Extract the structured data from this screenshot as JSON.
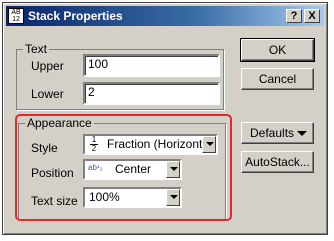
{
  "window": {
    "title": "Stack Properties",
    "help_btn": "?",
    "close_btn": "X"
  },
  "text_group": {
    "label": "Text",
    "upper_label": "Upper",
    "upper_value": "100",
    "lower_label": "Lower",
    "lower_value": "2"
  },
  "appearance_group": {
    "label": "Appearance",
    "style_label": "Style",
    "style_value": "Fraction (Horizontal)",
    "style_icon_num": "1",
    "style_icon_den": "2",
    "position_label": "Position",
    "position_value": "Center",
    "position_icon": "ab¹₂",
    "textsize_label": "Text size",
    "textsize_value": "100%"
  },
  "buttons": {
    "ok": "OK",
    "cancel": "Cancel",
    "defaults": "Defaults",
    "autostack": "AutoStack..."
  },
  "colors": {
    "title_bar": "#0a246a",
    "highlight": "#e12a2a",
    "dialog_bg": "#d4d0c8"
  }
}
